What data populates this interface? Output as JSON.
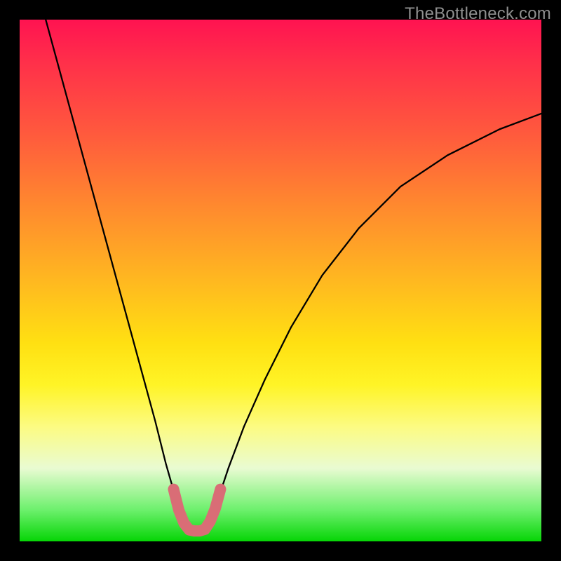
{
  "watermark": "TheBottleneck.com",
  "colors": {
    "curve": "#000000",
    "marker": "#d96d76",
    "background": "#000000"
  },
  "chart_data": {
    "type": "line",
    "title": "",
    "xlabel": "",
    "ylabel": "",
    "xlim": [
      0,
      100
    ],
    "ylim": [
      0,
      100
    ],
    "grid": false,
    "legend": false,
    "series": [
      {
        "name": "bottleneck_curve",
        "x": [
          5,
          8,
          11,
          14,
          17,
          20,
          23,
          26,
          28,
          30,
          31,
          32,
          33,
          34,
          35,
          36,
          37,
          38,
          40,
          43,
          47,
          52,
          58,
          65,
          73,
          82,
          92,
          100
        ],
        "y": [
          100,
          89,
          78,
          67,
          56,
          45,
          34,
          23,
          15,
          8,
          5,
          3,
          2,
          2,
          2,
          3,
          5,
          8,
          14,
          22,
          31,
          41,
          51,
          60,
          68,
          74,
          79,
          82
        ]
      },
      {
        "name": "optimal_zone_overlay",
        "x": [
          29.5,
          30.5,
          31.5,
          32.5,
          33.5,
          34.5,
          35.5,
          36.5,
          37.5,
          38.5
        ],
        "y": [
          10,
          6,
          3.5,
          2.2,
          2,
          2,
          2.3,
          3.8,
          6.3,
          10
        ]
      }
    ],
    "optimal_x": 34,
    "note": "Values estimated from pixels; chart has no axis ticks or labels."
  },
  "marker_style": {
    "stroke_width": 16
  }
}
